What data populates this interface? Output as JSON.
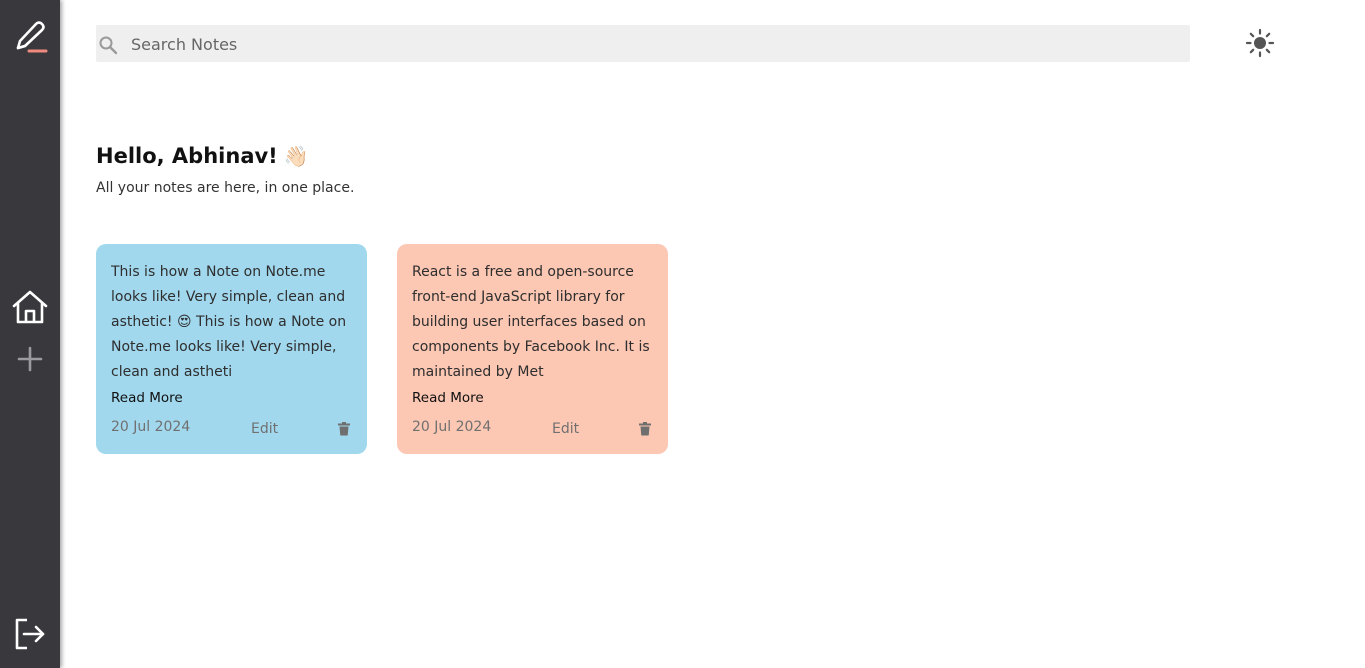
{
  "sidebar": {
    "items": [
      {
        "name": "logo",
        "icon": "pencil-icon",
        "accent": "#f08a7e"
      },
      {
        "name": "home",
        "icon": "home-icon"
      },
      {
        "name": "add",
        "icon": "plus-icon"
      },
      {
        "name": "logout",
        "icon": "logout-icon"
      }
    ],
    "background": "#38383d"
  },
  "search": {
    "placeholder": "Search Notes",
    "value": ""
  },
  "theme_toggle": {
    "icon": "sun-icon"
  },
  "greeting": {
    "title": "Hello, Abhinav!",
    "emoji": "👋🏻",
    "subtitle": "All your notes are here, in one place."
  },
  "notes": [
    {
      "content": "This is how a Note on Note.me looks like! Very simple, clean and asthetic! 😍 This is how a Note on Note.me looks like! Very simple, clean and astheti",
      "read_more": "Read More",
      "date": "20 Jul 2024",
      "edit": "Edit",
      "color": "#a1d8ee"
    },
    {
      "content": "React is a free and open-source front-end JavaScript library for building user interfaces based on components by Facebook Inc. It is maintained by Met",
      "read_more": "Read More",
      "date": "20 Jul 2024",
      "edit": "Edit",
      "color": "#fcc7b3"
    }
  ]
}
